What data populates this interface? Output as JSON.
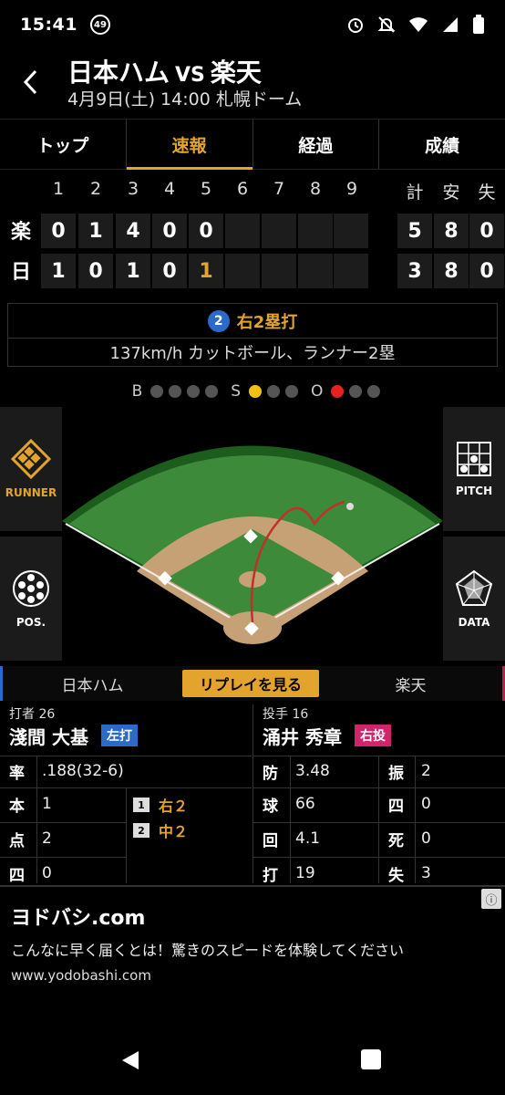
{
  "status": {
    "time": "15:41",
    "notif_count": "49"
  },
  "header": {
    "team_home": "日本ハム",
    "vs": "VS",
    "team_away": "楽天",
    "subtitle": "4月9日(土) 14:00 札幌ドーム"
  },
  "tabs": [
    "トップ",
    "速報",
    "経過",
    "成績"
  ],
  "active_tab": 1,
  "scoreboard": {
    "innings": [
      "1",
      "2",
      "3",
      "4",
      "5",
      "6",
      "7",
      "8",
      "9"
    ],
    "totals_headers": [
      "計",
      "安",
      "失"
    ],
    "teams": [
      {
        "label": "楽",
        "innings": [
          "0",
          "1",
          "4",
          "0",
          "0",
          "",
          "",
          "",
          ""
        ],
        "totals": [
          "5",
          "8",
          "0"
        ]
      },
      {
        "label": "日",
        "innings": [
          "1",
          "0",
          "1",
          "0",
          "1",
          "",
          "",
          "",
          ""
        ],
        "totals": [
          "3",
          "8",
          "0"
        ]
      }
    ]
  },
  "play": {
    "number": "2",
    "result": "右2塁打",
    "detail": "137km/h カットボール、ランナー2塁"
  },
  "count": {
    "b_label": "B",
    "s_label": "S",
    "o_label": "O",
    "balls": 0,
    "strikes": 1,
    "outs": 1
  },
  "side_buttons": {
    "runner": "RUNNER",
    "pos": "POS.",
    "pitch": "PITCH",
    "data": "DATA"
  },
  "teambar": {
    "left": "日本ハム",
    "replay": "リプレイを見る",
    "right": "楽天"
  },
  "batter": {
    "role": "打者 26",
    "name": "淺間 大基",
    "badge": "左打",
    "stats": [
      {
        "key": "率",
        "value": ".188(32-6)"
      },
      {
        "key": "本",
        "value": "1"
      },
      {
        "key": "点",
        "value": "2"
      },
      {
        "key": "四",
        "value": "0"
      }
    ],
    "at_bats": [
      {
        "num": "1",
        "result": "右２"
      },
      {
        "num": "2",
        "result": "中２"
      }
    ]
  },
  "pitcher": {
    "role": "投手 16",
    "name": "涌井 秀章",
    "badge": "右投",
    "stats_left": [
      {
        "key": "防",
        "value": "3.48"
      },
      {
        "key": "球",
        "value": "66"
      },
      {
        "key": "回",
        "value": "4.1"
      },
      {
        "key": "打",
        "value": "19"
      }
    ],
    "stats_right": [
      {
        "key": "振",
        "value": "2"
      },
      {
        "key": "四",
        "value": "0"
      },
      {
        "key": "死",
        "value": "0"
      },
      {
        "key": "失",
        "value": "3"
      }
    ]
  },
  "ad": {
    "title": "ヨドバシ.com",
    "text": "こんなに早く届くとは！驚きのスピードを体験してください",
    "url": "www.yodobashi.com",
    "info_icon": "ⓘ"
  }
}
